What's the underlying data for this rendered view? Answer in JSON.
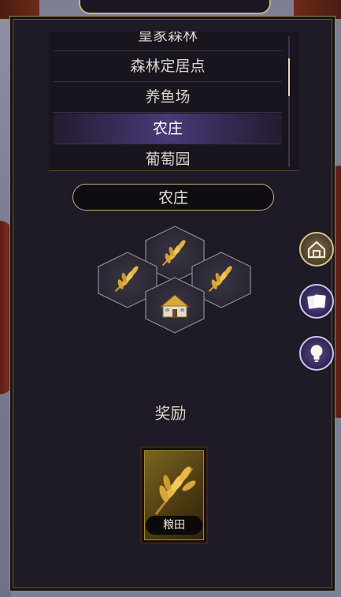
{
  "list": {
    "items": [
      {
        "label": "皇家森林"
      },
      {
        "label": "森林定居点"
      },
      {
        "label": "养鱼场"
      },
      {
        "label": "农庄"
      },
      {
        "label": "葡萄园"
      }
    ],
    "selected_index": 3
  },
  "selected_name": "农庄",
  "layout_icons": {
    "top": "wheat-icon",
    "left": "wheat-icon",
    "right": "wheat-icon",
    "center": "farmhouse-icon"
  },
  "side_buttons": [
    "home-icon",
    "cards-icon",
    "lightbulb-icon"
  ],
  "reward": {
    "title": "奖励",
    "card_label": "粮田",
    "card_icon": "wheat-icon"
  },
  "colors": {
    "panel_bg": "#1e1a26",
    "accent_gold": "#c2b27c",
    "selected_row": "#4a3a78"
  }
}
